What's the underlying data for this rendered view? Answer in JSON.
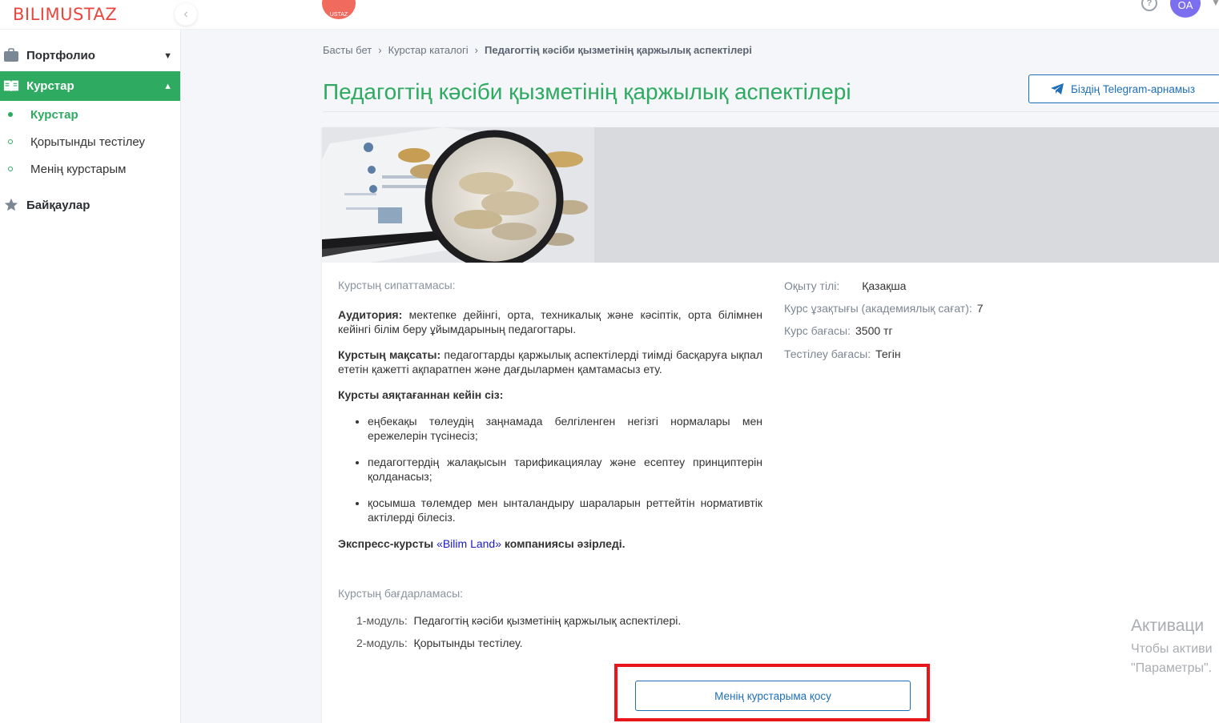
{
  "header": {
    "logo_text": "BILIMUSTAZ",
    "center_logo_text": "USTAZ",
    "avatar_initials": "OA",
    "help_icon": "question-circle-icon",
    "brand_color": "#e8473f"
  },
  "sidebar": {
    "items": [
      {
        "label": "Портфолио",
        "icon": "briefcase-icon",
        "expanded": false
      },
      {
        "label": "Курстар",
        "icon": "book-icon",
        "expanded": true,
        "active": true
      },
      {
        "label": "Байқаулар",
        "icon": "star-icon",
        "expanded": false
      }
    ],
    "subitems": [
      {
        "label": "Курстар",
        "current": true
      },
      {
        "label": "Қорытынды тестілеу",
        "current": false
      },
      {
        "label": "Менің курстарым",
        "current": false
      }
    ],
    "accent_color": "#2eaa61"
  },
  "breadcrumb": {
    "items": [
      "Басты бет",
      "Курстар каталогі",
      "Педагогтің кәсіби қызметінің қаржылық аспектілері"
    ]
  },
  "page": {
    "title": "Педагогтің кәсіби қызметінің қаржылық аспектілері",
    "telegram_button": "Біздің Telegram-арнамыз"
  },
  "description": {
    "label": "Курстың сипаттамасы:",
    "audience_label": "Аудитория:",
    "audience_text": " мектепке дейінгі, орта, техникалық және кәсіптік, орта білімнен кейінгі білім беру ұйымдарының педагогтары.",
    "goal_label": "Курстың мақсаты:",
    "goal_text": " педагогтарды қаржылық аспектілерді тиімді басқаруға ықпал ететін қажетті ақпаратпен және дағдылармен қамтамасыз ету.",
    "outcomes_label": "Курсты аяқтағаннан кейін сіз:",
    "outcomes": [
      "еңбекақы төлеудің заңнамада белгіленген негізгі нормалары мен ережелерін түсінесіз;",
      "педагогтердің жалақысын тарификациялау және есептеу принциптерін қолданасыз;",
      "қосымша төлемдер мен ынталандыру шараларын реттейтін нормативтік актілерді білесіз."
    ],
    "developer_prefix": "Экспресс-курсты ",
    "developer_link": "«Bilim Land»",
    "developer_suffix": " компаниясы әзірледі."
  },
  "info": {
    "language_label": "Оқыту тілі:",
    "language_value": "Қазақша",
    "duration_label": "Курс ұзақтығы (академиялық сағат):",
    "duration_value": "7",
    "price_label": "Курс бағасы:",
    "price_value": "3500 тг",
    "test_price_label": "Тестілеу бағасы:",
    "test_price_value": "Тегін"
  },
  "program": {
    "label": "Курстың бағдарламасы:",
    "modules": [
      {
        "name": "1-модуль:",
        "title": "Педагогтің кәсіби қызметінің қаржылық аспектілері."
      },
      {
        "name": "2-модуль:",
        "title": "Қорытынды тестілеу."
      }
    ]
  },
  "actions": {
    "add_button": "Менің курстарыма қосу",
    "highlight_color": "#e8151b"
  },
  "watermark": {
    "line1": "Активаци",
    "line2": "Чтобы активи",
    "line3": "\"Параметры\"."
  }
}
